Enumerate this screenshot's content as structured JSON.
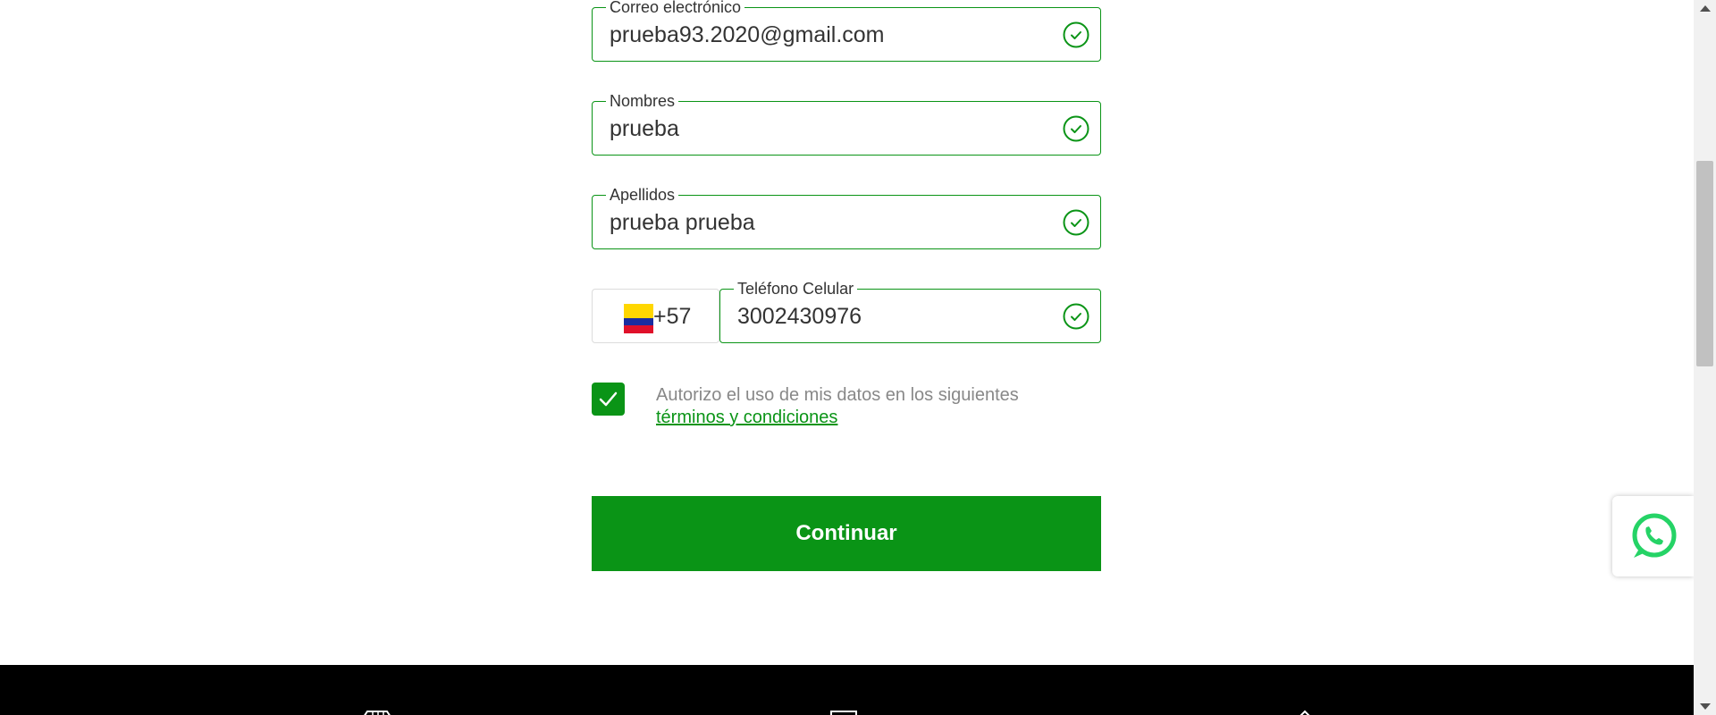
{
  "form": {
    "email": {
      "label": "Correo electrónico",
      "value": "prueba93.2020@gmail.com"
    },
    "nombres": {
      "label": "Nombres",
      "value": "prueba"
    },
    "apellidos": {
      "label": "Apellidos",
      "value": "prueba prueba"
    },
    "telefono": {
      "label": "Teléfono Celular",
      "value": "3002430976",
      "country_code": "+57",
      "country_flag": "colombia-flag-icon"
    },
    "consent": {
      "checked": true,
      "text": "Autorizo el uso de mis datos en los siguientes",
      "link": "términos y condiciones"
    },
    "submit_label": "Continuar"
  },
  "colors": {
    "accent": "#0a9416",
    "footer": "#000000",
    "whatsapp": "#25d366"
  },
  "icons": {
    "valid": "check-circle-icon",
    "whatsapp": "whatsapp-icon"
  }
}
